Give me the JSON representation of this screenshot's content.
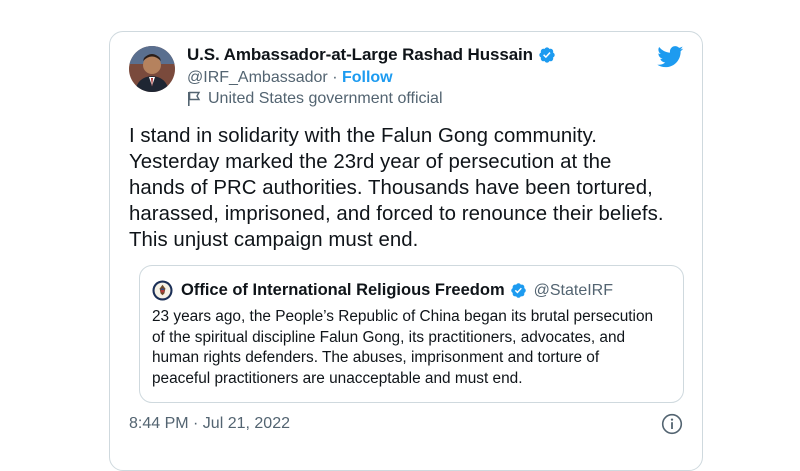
{
  "author": {
    "name": "U.S. Ambassador-at-Large Rashad Hussain",
    "handle": "@IRF_Ambassador",
    "separator": "·",
    "follow_label": "Follow",
    "label": "United States government official",
    "avatar_icon": "profile-photo"
  },
  "tweet": {
    "text": "I stand in solidarity with the Falun Gong community.\nYesterday marked the 23rd year of persecution at the\nhands of PRC authorities. Thousands have been tortured,\nharassed, imprisoned, and forced to renounce their beliefs.\nThis unjust campaign must end.",
    "timestamp": "8:44 PM · Jul 21, 2022"
  },
  "quote": {
    "name": "Office of International Religious Freedom",
    "handle": "@StateIRF",
    "text": "23 years ago, the People’s Republic of China began its brutal persecution\nof the spiritual discipline Falun Gong, its practitioners, advocates, and\nhuman rights defenders. The abuses, imprisonment and torture of\npeaceful practitioners are unacceptable and must end.",
    "avatar_icon": "state-department-seal"
  },
  "colors": {
    "brand_blue": "#1d9bf0",
    "secondary_text": "#536471",
    "border": "#cfd9de"
  }
}
